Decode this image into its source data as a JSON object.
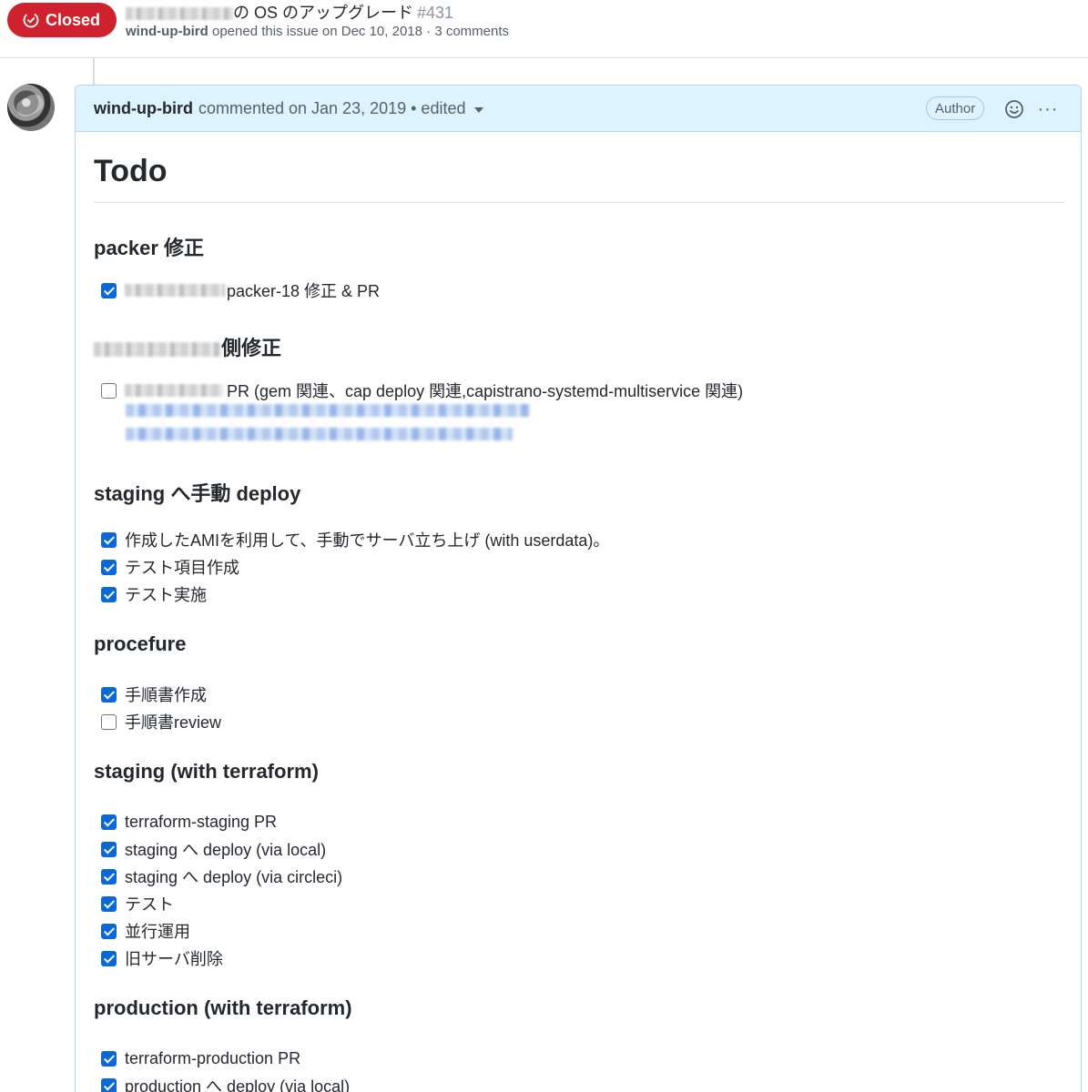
{
  "header": {
    "state_label": "Closed",
    "title_text": "の OS のアップグレード",
    "issue_number": "#431",
    "author": "wind-up-bird",
    "opened_text": "opened this issue on Dec 10, 2018 · 3 comments"
  },
  "comment": {
    "author": "wind-up-bird",
    "meta": "commented on Jan 23, 2019 • edited",
    "author_badge": "Author",
    "more_label": "···"
  },
  "body": {
    "title": "Todo",
    "sections": [
      {
        "heading": "packer 修正",
        "tasks": [
          {
            "label": "packer-18 修正 & PR",
            "checked": true
          }
        ]
      },
      {
        "heading": "側修正",
        "tasks": [
          {
            "label": "PR (gem 関連、cap deploy 関連,capistrano-systemd-multiservice 関連)",
            "checked": false
          }
        ]
      },
      {
        "heading": "staging へ手動 deploy",
        "tasks": [
          {
            "label": "作成したAMIを利用して、手動でサーバ立ち上げ (with userdata)。",
            "checked": true
          },
          {
            "label": "テスト項目作成",
            "checked": true
          },
          {
            "label": "テスト実施",
            "checked": true
          }
        ]
      },
      {
        "heading": "procefure",
        "tasks": [
          {
            "label": "手順書作成",
            "checked": true
          },
          {
            "label": "手順書review",
            "checked": false
          }
        ]
      },
      {
        "heading": "staging (with terraform)",
        "tasks": [
          {
            "label": "terraform-staging PR",
            "checked": true
          },
          {
            "label": "staging へ deploy (via local)",
            "checked": true
          },
          {
            "label": "staging へ deploy (via circleci)",
            "checked": true
          },
          {
            "label": "テスト",
            "checked": true
          },
          {
            "label": "並行運用",
            "checked": true
          },
          {
            "label": "旧サーバ削除",
            "checked": true
          }
        ]
      },
      {
        "heading": "production (with terraform)",
        "tasks": [
          {
            "label": "terraform-production PR",
            "checked": true
          },
          {
            "label": "production へ deploy (via local)",
            "checked": true
          }
        ]
      }
    ]
  }
}
